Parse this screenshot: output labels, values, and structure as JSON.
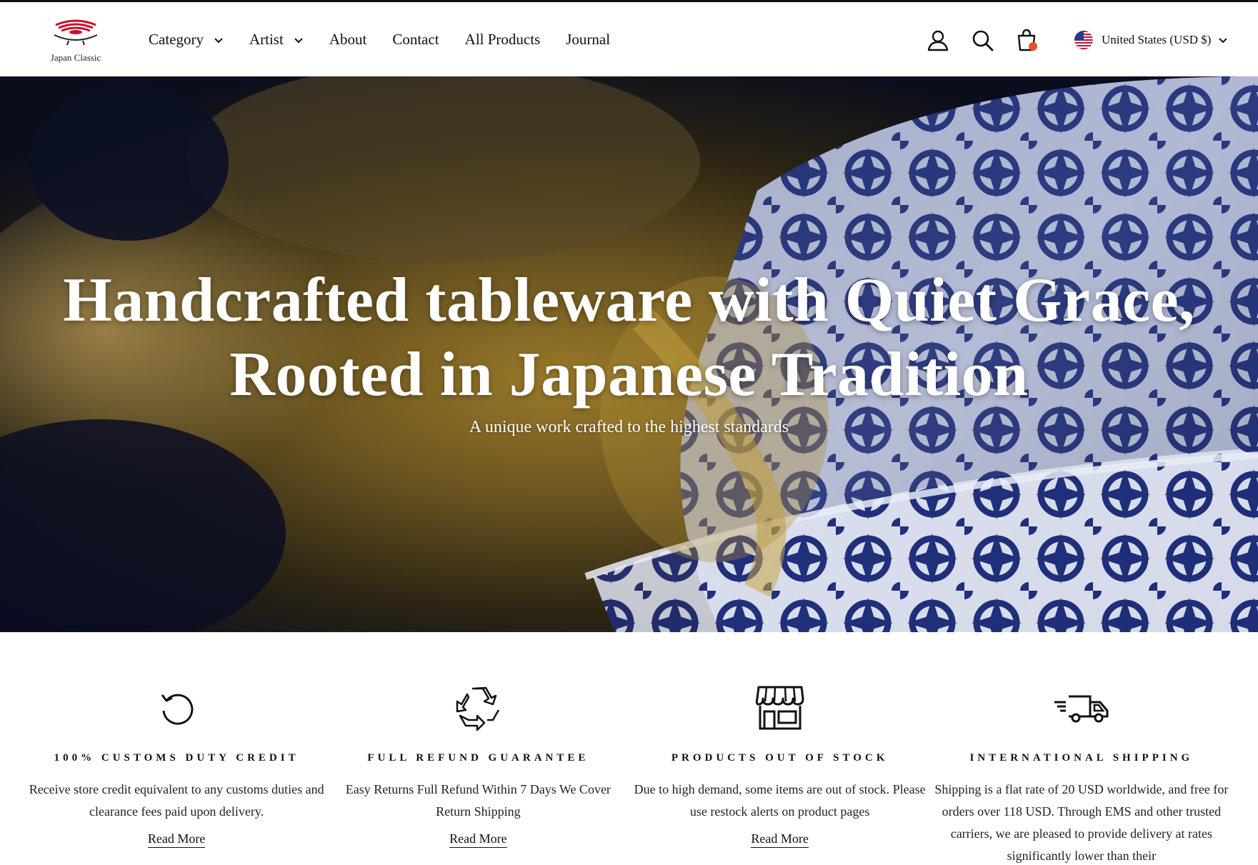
{
  "brand": {
    "name": "Japan Classic",
    "accent": "#c8102e"
  },
  "nav": {
    "items": [
      {
        "label": "Category",
        "has_dropdown": true
      },
      {
        "label": "Artist",
        "has_dropdown": true
      },
      {
        "label": "About",
        "has_dropdown": false
      },
      {
        "label": "Contact",
        "has_dropdown": false
      },
      {
        "label": "All Products",
        "has_dropdown": false
      },
      {
        "label": "Journal",
        "has_dropdown": false
      }
    ]
  },
  "header_icons": [
    "user-icon",
    "search-icon",
    "cart-icon"
  ],
  "cart_badge_color": "#e8512f",
  "country": {
    "label": "United States (USD $)",
    "flag": "us-flag-icon"
  },
  "hero": {
    "title_line1": "Handcrafted tableware with Quiet Grace,",
    "title_line2": "Rooted in Japanese Tradition",
    "subtitle": "A unique work crafted to the highest standards"
  },
  "features": [
    {
      "icon": "refresh-icon",
      "title": "100% CUSTOMS DUTY CREDIT",
      "text": "Receive store credit equivalent to any customs duties and clearance fees paid upon delivery.",
      "link": "Read More"
    },
    {
      "icon": "recycle-icon",
      "title": "FULL REFUND GUARANTEE",
      "text": "Easy Returns Full Refund Within 7 Days We Cover Return Shipping",
      "link": "Read More"
    },
    {
      "icon": "store-icon",
      "title": "PRODUCTS OUT OF STOCK",
      "text": "Due to high demand, some items are out of stock. Please use restock alerts on product pages",
      "link": "Read More"
    },
    {
      "icon": "truck-icon",
      "title": "INTERNATIONAL SHIPPING",
      "text": "Shipping is a flat rate of 20 USD worldwide, and free for orders over 118 USD. Through EMS and other trusted carriers, we are pleased to provide delivery at rates significantly lower than their"
    }
  ]
}
